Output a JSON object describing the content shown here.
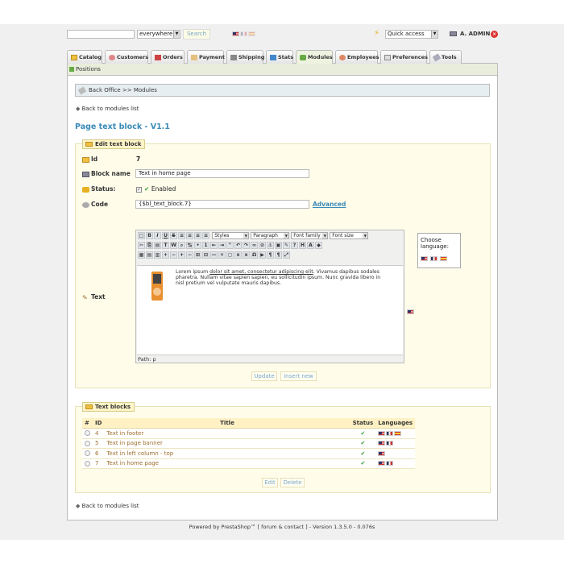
{
  "topbar": {
    "search_placeholder": "",
    "search_scope": "everywhere",
    "search_button": "Search",
    "quick_access": "Quick access",
    "admin_name": "A. ADMIN"
  },
  "tabs": [
    {
      "label": "Catalog"
    },
    {
      "label": "Customers"
    },
    {
      "label": "Orders"
    },
    {
      "label": "Payment"
    },
    {
      "label": "Shipping"
    },
    {
      "label": "Stats"
    },
    {
      "label": "Modules",
      "active": true
    },
    {
      "label": "Employees"
    },
    {
      "label": "Preferences"
    },
    {
      "label": "Tools"
    }
  ],
  "subtab": {
    "label": "Positions"
  },
  "breadcrumb": {
    "text": "Back Office >> Modules"
  },
  "nav": {
    "back_top": "Back to modules list",
    "back_bottom": "Back to modules list"
  },
  "page_title": "Page text block - V1.1",
  "edit_form": {
    "legend": "Edit text block",
    "id_label": "Id",
    "id_value": "7",
    "name_label": "Block name",
    "name_value": "Text in home page",
    "status_label": "Status:",
    "status_value": "Enabled",
    "code_label": "Code",
    "code_value": "{$bl_text_block.7}",
    "advanced_link": "Advanced",
    "text_label": "Text",
    "editor_styles": "Styles",
    "editor_format": "Paragraph",
    "editor_font_family": "Font family",
    "editor_font_size": "Font size",
    "editor_content_plain1": "Lorem ipsum ",
    "editor_content_link": "dolor sit amet, consectetur adipiscing elit",
    "editor_content_plain2": ". Vivamus dapibus sodales pharetra. Nullam vitae sapien sapien, eu sollicitudin ipsum. Nunc gravida libero in nisl pretium vel vulputate mauris dapibus.",
    "editor_path": "Path: p",
    "choose_language": "Choose language:",
    "update_button": "Update",
    "insert_button": "Insert new"
  },
  "blocks": {
    "legend": "Text blocks",
    "columns": {
      "hash": "#",
      "id": "ID",
      "title": "Title",
      "status": "Status",
      "languages": "Languages"
    },
    "rows": [
      {
        "id": "4",
        "title": "Text in footer",
        "langs": [
          "us",
          "fr",
          "es"
        ]
      },
      {
        "id": "5",
        "title": "Text in page banner",
        "langs": [
          "us",
          "fr"
        ]
      },
      {
        "id": "6",
        "title": "Text in left column - top",
        "langs": [
          "us"
        ]
      },
      {
        "id": "7",
        "title": "Text in home page",
        "langs": [
          "us",
          "fr"
        ]
      }
    ],
    "edit_button": "Edit",
    "delete_button": "Delete"
  },
  "footer": {
    "text": "Powered by PrestaShop™ [ forum & contact ] - Version 1.3.5.0 - 0.076s"
  },
  "colors": {
    "accent": "#3a8ab8",
    "panel": "#fffcea",
    "tab_active": "#eef3e0"
  }
}
